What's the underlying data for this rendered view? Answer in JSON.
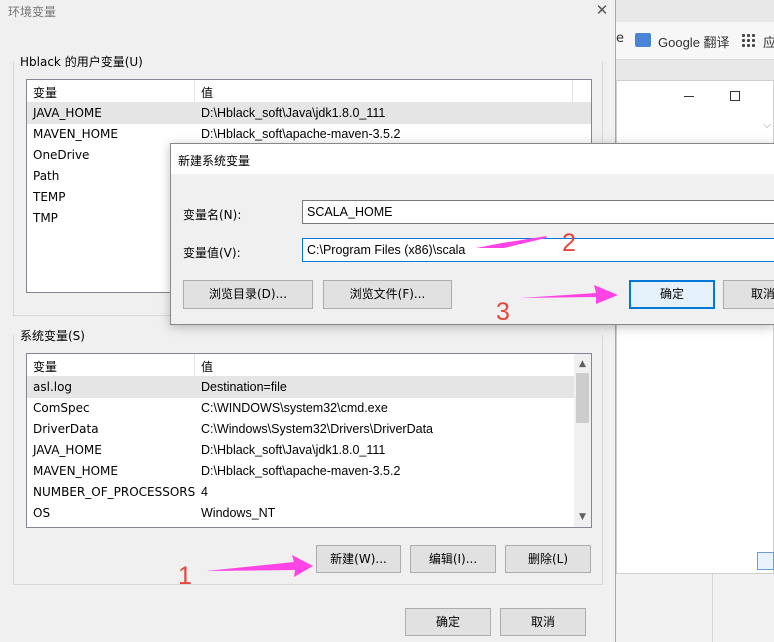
{
  "browser": {
    "partial_text": "e",
    "translate_label": "Google 翻译",
    "apps_partial": "应"
  },
  "main_dialog": {
    "title": "环境变量",
    "close_glyph": "✕",
    "user_section": {
      "label": "Hblack 的用户变量(U)",
      "col_name": "变量",
      "col_value": "值",
      "rows": [
        {
          "name": "JAVA_HOME",
          "value": "D:\\Hblack_soft\\Java\\jdk1.8.0_111"
        },
        {
          "name": "MAVEN_HOME",
          "value": "D:\\Hblack_soft\\apache-maven-3.5.2"
        },
        {
          "name": "OneDrive",
          "value": ""
        },
        {
          "name": "Path",
          "value": ""
        },
        {
          "name": "TEMP",
          "value": ""
        },
        {
          "name": "TMP",
          "value": ""
        }
      ]
    },
    "system_section": {
      "label": "系统变量(S)",
      "col_name": "变量",
      "col_value": "值",
      "rows": [
        {
          "name": "asl.log",
          "value": "Destination=file"
        },
        {
          "name": "ComSpec",
          "value": "C:\\WINDOWS\\system32\\cmd.exe"
        },
        {
          "name": "DriverData",
          "value": "C:\\Windows\\System32\\Drivers\\DriverData"
        },
        {
          "name": "JAVA_HOME",
          "value": "D:\\Hblack_soft\\Java\\jdk1.8.0_111"
        },
        {
          "name": "MAVEN_HOME",
          "value": "D:\\Hblack_soft\\apache-maven-3.5.2"
        },
        {
          "name": "NUMBER_OF_PROCESSORS",
          "value": "4"
        },
        {
          "name": "OS",
          "value": "Windows_NT"
        }
      ],
      "buttons": {
        "new": "新建(W)...",
        "edit": "编辑(I)...",
        "delete": "删除(L)"
      }
    },
    "ok": "确定",
    "cancel": "取消"
  },
  "new_var_dialog": {
    "title": "新建系统变量",
    "name_label": "变量名(N):",
    "name_value": "SCALA_HOME",
    "value_label": "变量值(V):",
    "value_value": "C:\\Program Files (x86)\\scala",
    "browse_dir": "浏览目录(D)...",
    "browse_file": "浏览文件(F)...",
    "ok": "确定",
    "cancel_partial": "取消"
  },
  "annotations": {
    "step1": "1",
    "step2": "2",
    "step3": "3",
    "color": "#ff44e5",
    "number_color": "#e8453c"
  },
  "scroll": {
    "up": "▲",
    "down": "▼",
    "chevron": "⌵"
  }
}
